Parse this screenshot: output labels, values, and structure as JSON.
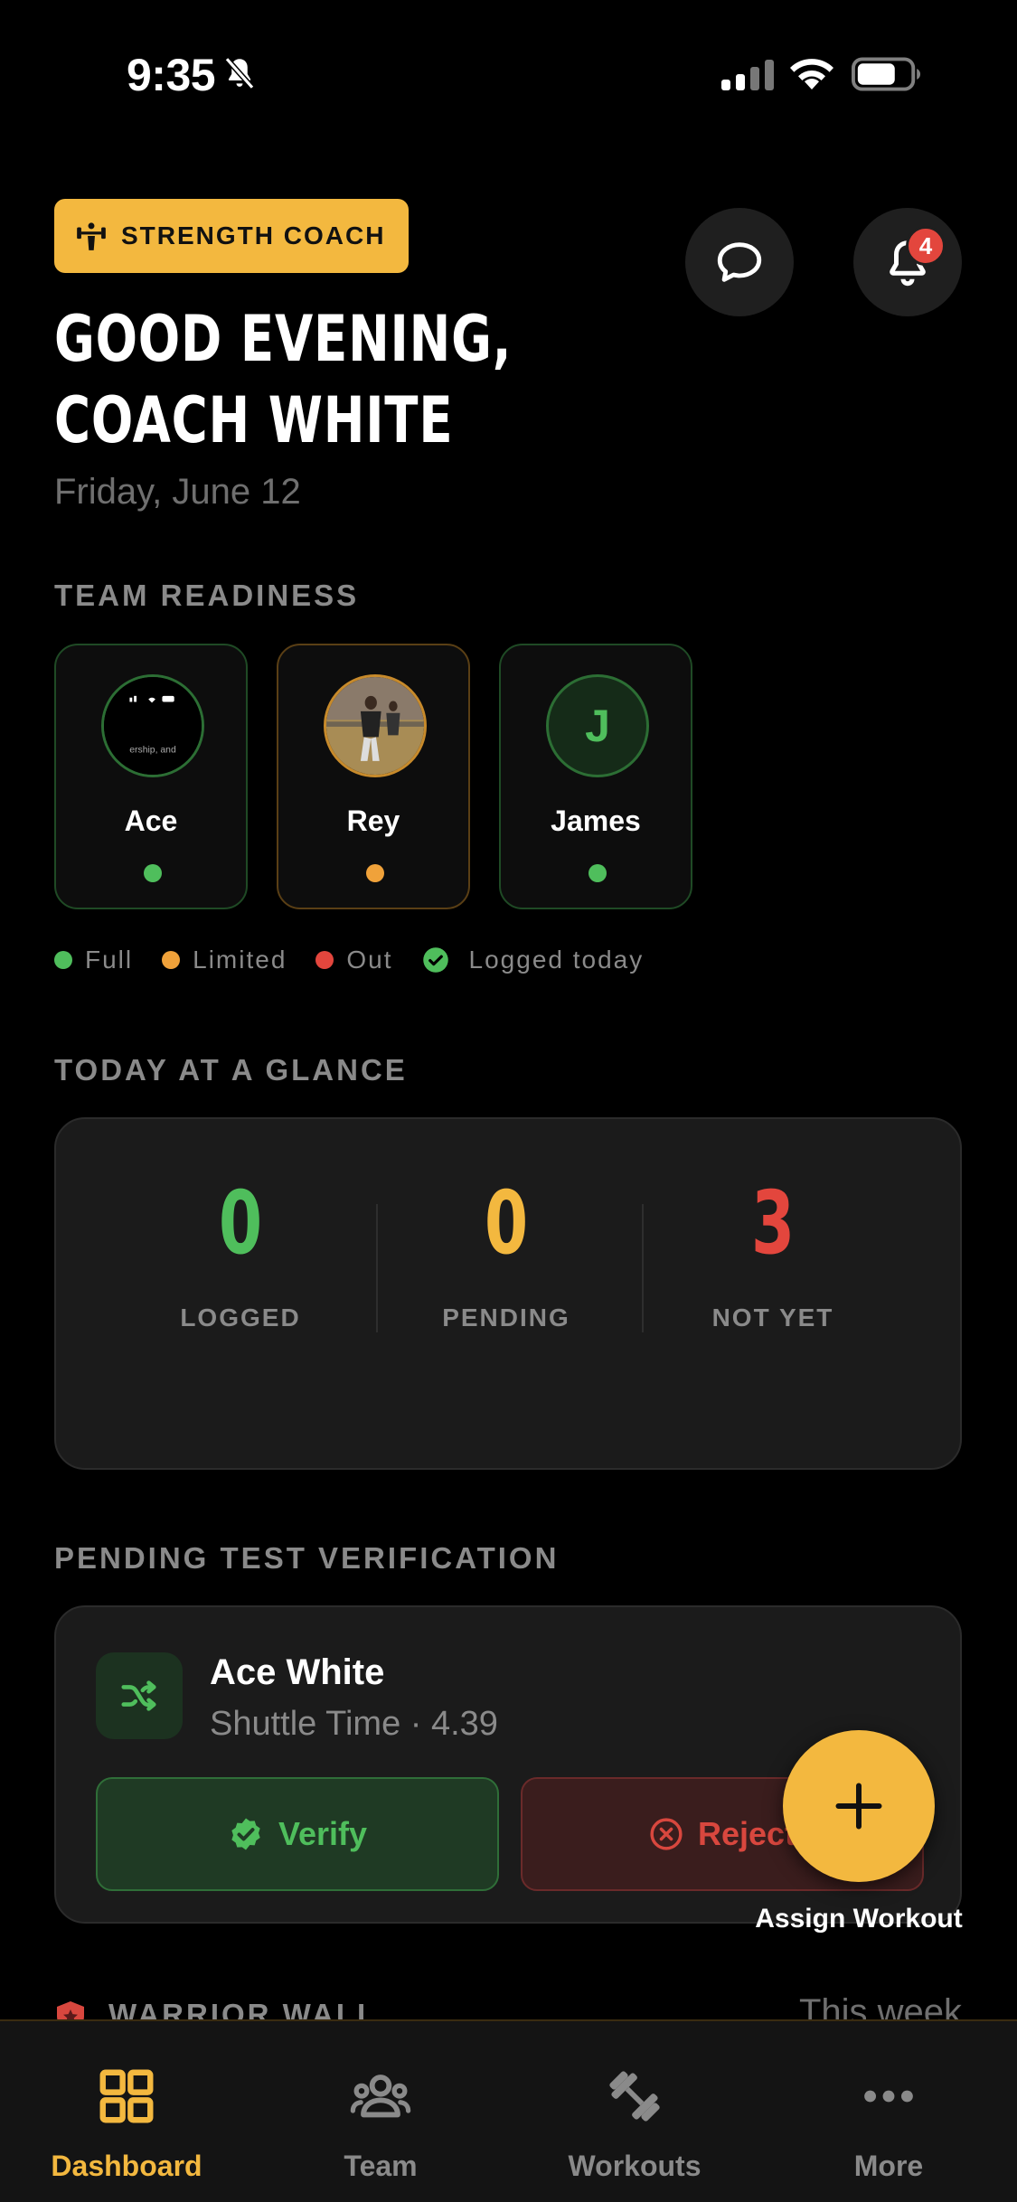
{
  "status_bar": {
    "time": "9:35"
  },
  "header": {
    "role_badge": "STRENGTH COACH",
    "greeting": "GOOD EVENING, COACH WHITE",
    "date": "Friday, June 12",
    "notification_count": "4"
  },
  "readiness": {
    "title": "TEAM READINESS",
    "athletes": [
      {
        "name": "Ace",
        "status": "full",
        "avatar_type": "screenshot",
        "avatar_snippet": "ership, and"
      },
      {
        "name": "Rey",
        "status": "limited",
        "avatar_type": "photo"
      },
      {
        "name": "James",
        "status": "full",
        "avatar_type": "initial",
        "initial": "J"
      }
    ],
    "legend": {
      "full": "Full",
      "limited": "Limited",
      "out": "Out",
      "logged": "Logged today"
    }
  },
  "glance": {
    "title": "TODAY AT A GLANCE",
    "stats": [
      {
        "value": "0",
        "label": "LOGGED",
        "color": "#4fbe5c"
      },
      {
        "value": "0",
        "label": "PENDING",
        "color": "#f3b83f"
      },
      {
        "value": "3",
        "label": "NOT YET",
        "color": "#e3463d"
      }
    ]
  },
  "pending_verification": {
    "title": "PENDING TEST VERIFICATION",
    "athlete": "Ace White",
    "detail": "Shuttle Time · 4.39",
    "verify_label": "Verify",
    "reject_label": "Reject"
  },
  "fab": {
    "label": "Assign Workout"
  },
  "warrior_wall": {
    "title": "WARRIOR WALL",
    "period": "This week"
  },
  "tabs": [
    {
      "label": "Dashboard",
      "active": true
    },
    {
      "label": "Team",
      "active": false
    },
    {
      "label": "Workouts",
      "active": false
    },
    {
      "label": "More",
      "active": false
    }
  ],
  "colors": {
    "accent": "#f3b83f",
    "full": "#4fbe5c",
    "limited": "#f0a23a",
    "out": "#e3463d"
  }
}
